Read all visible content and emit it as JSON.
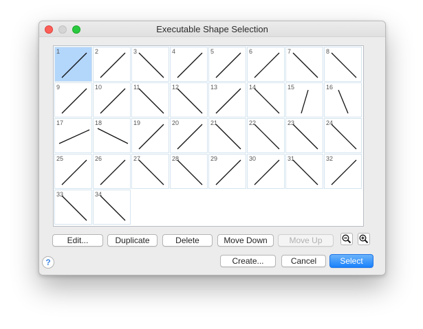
{
  "window": {
    "title": "Executable Shape Selection"
  },
  "shapes": [
    {
      "num": "1",
      "dir": "up"
    },
    {
      "num": "2",
      "dir": "up"
    },
    {
      "num": "3",
      "dir": "down"
    },
    {
      "num": "4",
      "dir": "up"
    },
    {
      "num": "5",
      "dir": "up"
    },
    {
      "num": "6",
      "dir": "up"
    },
    {
      "num": "7",
      "dir": "down"
    },
    {
      "num": "8",
      "dir": "down"
    },
    {
      "num": "9",
      "dir": "up"
    },
    {
      "num": "10",
      "dir": "up"
    },
    {
      "num": "11",
      "dir": "down"
    },
    {
      "num": "12",
      "dir": "down"
    },
    {
      "num": "13",
      "dir": "up"
    },
    {
      "num": "14",
      "dir": "down"
    },
    {
      "num": "15",
      "dir": "steep-up"
    },
    {
      "num": "16",
      "dir": "steep-down"
    },
    {
      "num": "17",
      "dir": "shallow-up"
    },
    {
      "num": "18",
      "dir": "shallow-down"
    },
    {
      "num": "19",
      "dir": "up"
    },
    {
      "num": "20",
      "dir": "up"
    },
    {
      "num": "21",
      "dir": "down"
    },
    {
      "num": "22",
      "dir": "down"
    },
    {
      "num": "23",
      "dir": "down"
    },
    {
      "num": "24",
      "dir": "down"
    },
    {
      "num": "25",
      "dir": "up"
    },
    {
      "num": "26",
      "dir": "up"
    },
    {
      "num": "27",
      "dir": "down"
    },
    {
      "num": "28",
      "dir": "down"
    },
    {
      "num": "29",
      "dir": "up"
    },
    {
      "num": "30",
      "dir": "up"
    },
    {
      "num": "31",
      "dir": "down"
    },
    {
      "num": "32",
      "dir": "up"
    },
    {
      "num": "33",
      "dir": "down"
    },
    {
      "num": "34",
      "dir": "down"
    }
  ],
  "selected_shape": "1",
  "buttons": {
    "edit": "Edit...",
    "duplicate": "Duplicate",
    "delete": "Delete",
    "move_down": "Move Down",
    "move_up": "Move Up",
    "create": "Create...",
    "cancel": "Cancel",
    "select": "Select"
  },
  "help": "?",
  "icons": {
    "zoom_out": "zoom-out-icon",
    "zoom_in": "zoom-in-icon",
    "help": "help-icon"
  },
  "colors": {
    "accent": "#1a82fb",
    "selection": "#b3d6fb"
  }
}
